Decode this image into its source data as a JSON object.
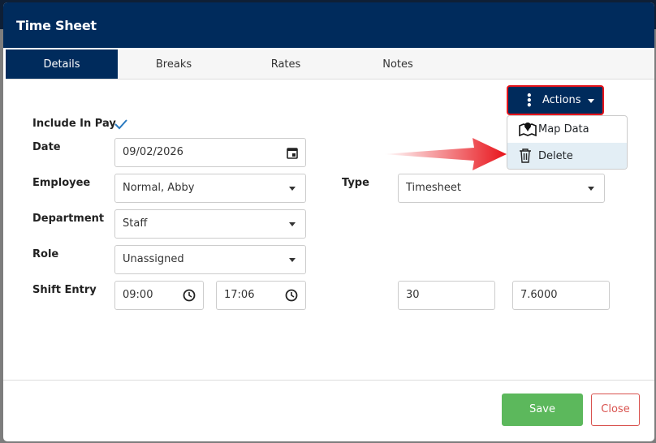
{
  "modal": {
    "title": "Time Sheet"
  },
  "tabs": [
    {
      "label": "Details"
    },
    {
      "label": "Breaks"
    },
    {
      "label": "Rates"
    },
    {
      "label": "Notes"
    }
  ],
  "actions": {
    "label": "Actions",
    "menu": [
      {
        "label": "Map Data",
        "icon": "map-icon"
      },
      {
        "label": "Delete",
        "icon": "trash-icon"
      }
    ]
  },
  "form": {
    "include_in_pay": {
      "label": "Include In Pay",
      "checked": true
    },
    "date": {
      "label": "Date",
      "value": "09/02/2026"
    },
    "employee": {
      "label": "Employee",
      "value": "Normal, Abby"
    },
    "type": {
      "label": "Type",
      "value": "Timesheet"
    },
    "department": {
      "label": "Department",
      "value": "Staff"
    },
    "role": {
      "label": "Role",
      "value": "Unassigned"
    },
    "shift": {
      "label": "Shift Entry",
      "start": "09:00",
      "end": "17:06",
      "break": "30",
      "hours": "7.6000"
    }
  },
  "footer": {
    "save": "Save",
    "close": "Close"
  },
  "colors": {
    "primary": "#002b5c",
    "save": "#5cb85c",
    "close": "#d9534f",
    "highlight": "#e8141b"
  }
}
